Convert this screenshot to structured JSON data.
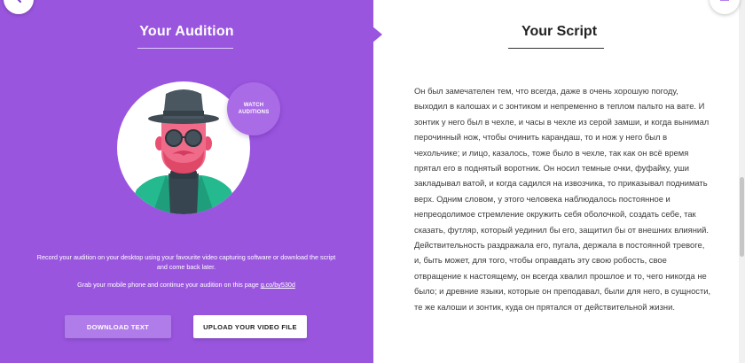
{
  "left_panel": {
    "title": "Your Audition",
    "watch_button": "WATCH\nAUDITIONS",
    "info_text_1": "Record your audition on your desktop using your favourite video capturing software or download the script and come back later.",
    "info_text_2_prefix": "Grab your mobile phone and continue your audition on this page",
    "info_link": "g.co/by530d",
    "download_button": "DOWNLOAD TEXT",
    "upload_button": "UPLOAD YOUR VIDEO FILE",
    "accent_color": "#9a55df"
  },
  "right_panel": {
    "title": "Your Script",
    "script_text": "Он был замечателен тем, что всегда, даже в очень хорошую погоду, выходил в калошах и с зонтиком и непременно в теплом пальто на вате. И зонтик у него был в чехле, и часы в чехле из серой замши, и когда вынимал перочинный нож, чтобы очинить карандаш, то и нож у него был в чехольчике; и лицо, казалось, тоже было в чехле, так как он всё время прятал его в поднятый воротник. Он носил темные очки, фуфайку, уши закладывал ватой, и когда садился на извозчика, то приказывал поднимать верх. Одним словом, у этого человека наблюдалось постоянное и непреодолимое стремление окружить себя оболочкой, создать себе, так сказать, футляр, который уединил бы его, защитил бы от внешних влияний. Действительность раздражала его, пугала, держала в постоянной тревоге, и, быть может, для того, чтобы оправдать эту свою робость, свое отвращение к настоящему, он всегда хвалил прошлое и то, чего никогда не было; и древние языки, которые он преподавал, были для него, в сущности, те же калоши и зонтик, куда он прятался от действительной жизни."
  },
  "icons": {
    "back": "chevron-left-icon",
    "menu": "hamburger-menu-icon"
  }
}
